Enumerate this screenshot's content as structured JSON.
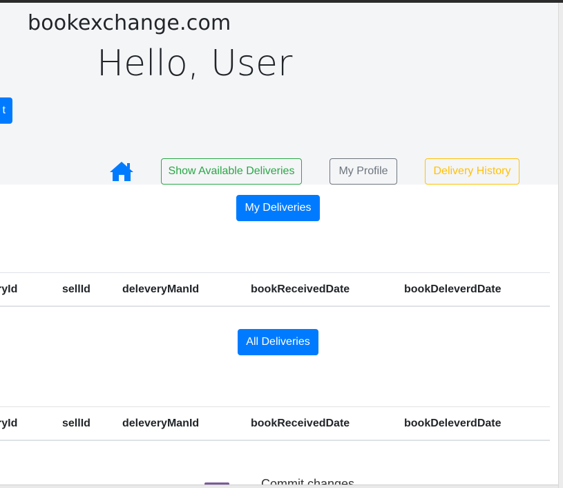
{
  "header": {
    "brand": "bookexchange.com",
    "greeting": "Hello, User",
    "cut_button_label": "t"
  },
  "nav": {
    "home_icon": "home-icon",
    "show_available_label": "Show Available Deliveries",
    "my_profile_label": "My Profile",
    "delivery_history_label": "Delivery History"
  },
  "my_deliveries": {
    "button_label": "My Deliveries",
    "columns": [
      "ryId",
      "sellId",
      "deleveryManId",
      "bookReceivedDate",
      "bookDeleverdDate"
    ]
  },
  "all_deliveries": {
    "button_label": "All Deliveries",
    "columns": [
      "ryId",
      "sellId",
      "deleveryManId",
      "bookReceivedDate",
      "bookDeleverdDate"
    ]
  },
  "background": {
    "partial_text": "Commit changes"
  },
  "colors": {
    "primary": "#007bff",
    "success": "#28a745",
    "secondary": "#6c757d",
    "warning": "#ffc107",
    "jumbotron": "#f4f5f7"
  }
}
